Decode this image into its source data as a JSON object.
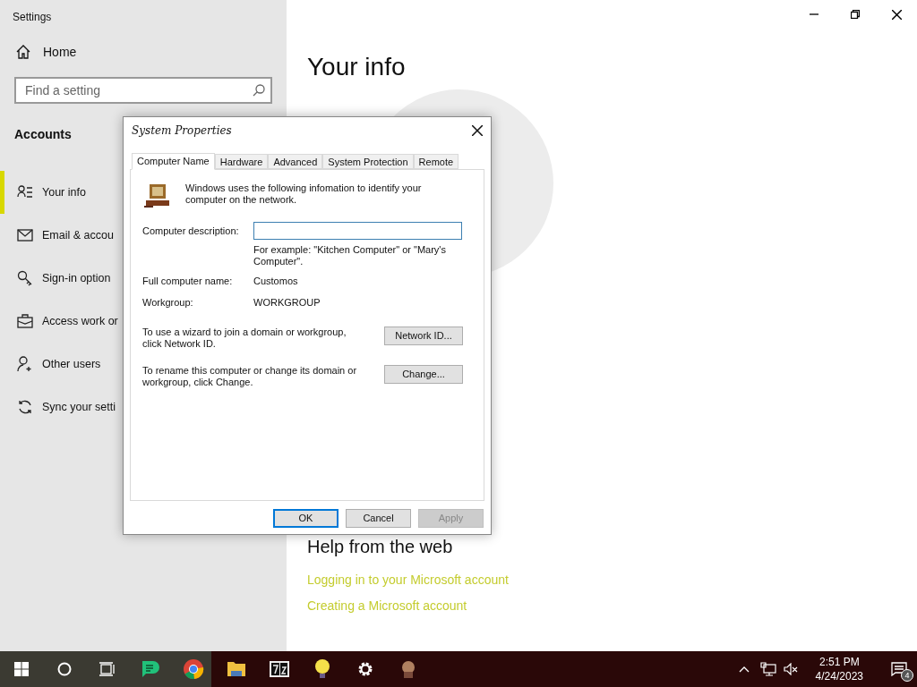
{
  "settings": {
    "title": "Settings",
    "home": "Home",
    "search": {
      "placeholder": "Find a setting"
    },
    "section": "Accounts",
    "nav_items": [
      {
        "kind": "person-list",
        "label": "Your info",
        "selected": true
      },
      {
        "kind": "mail",
        "label": "Email & accou",
        "selected": false
      },
      {
        "kind": "key",
        "label": "Sign-in option",
        "selected": false
      },
      {
        "kind": "briefcase",
        "label": "Access work or",
        "selected": false
      },
      {
        "kind": "person-add",
        "label": "Other users",
        "selected": false
      },
      {
        "kind": "sync",
        "label": "Sync your setti",
        "selected": false
      }
    ],
    "page_title": "Your info",
    "help_heading": "Help from the web",
    "help_links": [
      "Logging in to your Microsoft account",
      "Creating a Microsoft account"
    ]
  },
  "dialog": {
    "title": "System Properties",
    "tabs": [
      {
        "label": "Computer Name",
        "selected": true
      },
      {
        "label": "Hardware",
        "selected": false
      },
      {
        "label": "Advanced",
        "selected": false
      },
      {
        "label": "System Protection",
        "selected": false
      },
      {
        "label": "Remote",
        "selected": false
      }
    ],
    "intro": "Windows uses the following infomation to identify your computer on the network.",
    "description_label": "Computer description:",
    "example": "For example: \"Kitchen Computer\" or \"Mary's Computer\".",
    "rows": [
      {
        "label": "Full computer name:",
        "value": "Customos"
      },
      {
        "label": "Workgroup:",
        "value": "WORKGROUP"
      }
    ],
    "actions": [
      {
        "text": "To use a wizard to join a domain or workgroup, click Network ID.",
        "button": "Network ID..."
      },
      {
        "text": "To rename this computer or change its domain or workgroup, click Change.",
        "button": "Change..."
      }
    ],
    "buttons": [
      {
        "label": "OK",
        "default": true,
        "disabled": false
      },
      {
        "label": "Cancel",
        "default": false,
        "disabled": false
      },
      {
        "label": "Apply",
        "default": false,
        "disabled": true
      }
    ]
  },
  "taskbar": {
    "time": "2:51 PM",
    "date": "4/24/2023",
    "notifications": "4"
  }
}
